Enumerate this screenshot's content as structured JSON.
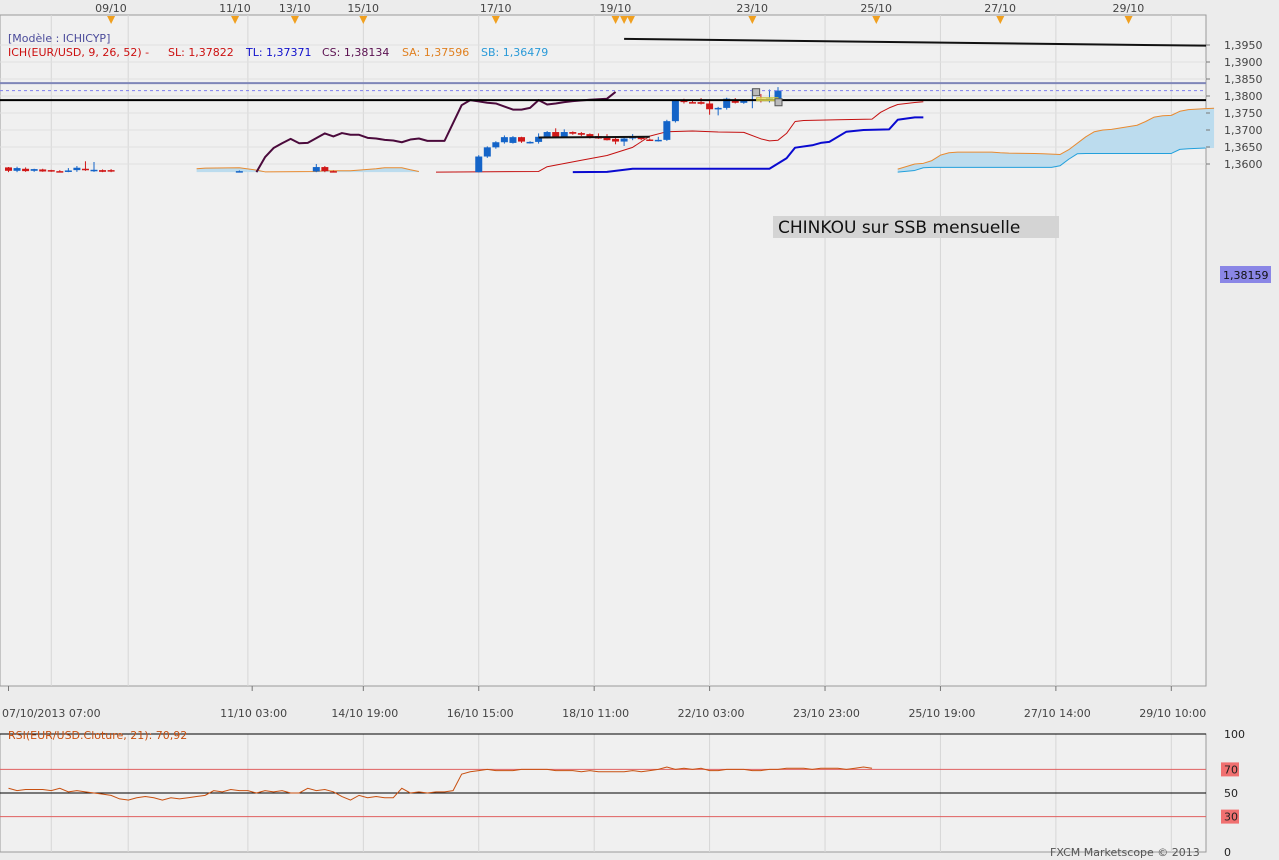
{
  "colors": {
    "background": "#ececec",
    "grid": "#d6d6d6",
    "bull": "#1464c8",
    "bear": "#d01818",
    "tenkan": "#c41010",
    "kijun": "#0a0ad0",
    "chikou": "#4b0a3c",
    "ssa": "#e88a30",
    "ssb": "#22a0dc",
    "cloud": "#bcdcee",
    "hline": "#000000",
    "blue_hline": "#7f86b8",
    "price_dash": "#8080ee",
    "price_tag": "#8a86e6",
    "rsi_line": "#c85010",
    "rsi_level": "#e06060",
    "annotation_bg": "#d6d6d6",
    "highlight": "#f4ee60"
  },
  "header": {
    "model_label": "[Modèle : ICHICYP]",
    "ich_label": "ICH(EUR/USD, 9, 26, 52) -",
    "sl": "SL: 1,37822",
    "tl": "TL: 1,37371",
    "cs": "CS: 1,38134",
    "sa": "SA: 1,37596",
    "sb": "SB: 1,36479"
  },
  "annotation": "CHINKOU sur SSB mensuelle",
  "current_price": "1,38159",
  "footer": "FXCM Marketscope © 2013",
  "chart_data": [
    {
      "type": "candlestick",
      "title": "",
      "symbol": "EUR/USD",
      "indicator": "Ichimoku (9, 26, 52)",
      "ylim": [
        1.3575,
        1.3975
      ],
      "y_ticks": [
        "1,3600",
        "1,3650",
        "1,3700",
        "1,3750",
        "1,3800",
        "1,3850",
        "1,3900",
        "1,3950"
      ],
      "x_tick_labels": [
        "07/10/2013 07:00",
        "11/10 03:00",
        "14/10 19:00",
        "16/10 15:00",
        "18/10 11:00",
        "22/10 03:00",
        "23/10 23:00",
        "25/10 19:00",
        "27/10 14:00",
        "29/10 10:00"
      ],
      "top_date_markers": [
        "09/10",
        "11/10",
        "13/10",
        "15/10",
        "17/10",
        "19/10",
        "23/10",
        "25/10",
        "27/10",
        "29/10"
      ],
      "candles": [
        {
          "i": 0,
          "o": 1.359,
          "h": 1.3591,
          "l": 1.3576,
          "c": 1.358
        },
        {
          "i": 1,
          "o": 1.358,
          "h": 1.3592,
          "l": 1.3576,
          "c": 1.3588
        },
        {
          "i": 2,
          "o": 1.3586,
          "h": 1.359,
          "l": 1.3577,
          "c": 1.3579
        },
        {
          "i": 3,
          "o": 1.358,
          "h": 1.3586,
          "l": 1.3577,
          "c": 1.3585
        },
        {
          "i": 4,
          "o": 1.3584,
          "h": 1.3586,
          "l": 1.3577,
          "c": 1.3578
        },
        {
          "i": 5,
          "o": 1.3582,
          "h": 1.3583,
          "l": 1.3577,
          "c": 1.3579
        },
        {
          "i": 6,
          "o": 1.3579,
          "h": 1.3582,
          "l": 1.3576,
          "c": 1.3577
        },
        {
          "i": 7,
          "o": 1.3579,
          "h": 1.3588,
          "l": 1.3576,
          "c": 1.3581
        },
        {
          "i": 8,
          "o": 1.3582,
          "h": 1.3594,
          "l": 1.3577,
          "c": 1.3589
        },
        {
          "i": 9,
          "o": 1.3586,
          "h": 1.3608,
          "l": 1.358,
          "c": 1.3582
        },
        {
          "i": 10,
          "o": 1.3582,
          "h": 1.3606,
          "l": 1.3577,
          "c": 1.3583
        },
        {
          "i": 11,
          "o": 1.3582,
          "h": 1.3584,
          "l": 1.3576,
          "c": 1.3577
        },
        {
          "i": 12,
          "o": 1.3582,
          "h": 1.3585,
          "l": 1.3576,
          "c": 1.3578
        },
        {
          "i": 27,
          "o": 1.3578,
          "h": 1.3581,
          "l": 1.3576,
          "c": 1.3579
        },
        {
          "i": 36,
          "o": 1.3578,
          "h": 1.36,
          "l": 1.3576,
          "c": 1.3591
        },
        {
          "i": 37,
          "o": 1.3591,
          "h": 1.3594,
          "l": 1.3576,
          "c": 1.3579
        },
        {
          "i": 38,
          "o": 1.3579,
          "h": 1.3581,
          "l": 1.3576,
          "c": 1.3577
        },
        {
          "i": 55,
          "o": 1.3576,
          "h": 1.3626,
          "l": 1.3575,
          "c": 1.3622
        },
        {
          "i": 56,
          "o": 1.3622,
          "h": 1.3652,
          "l": 1.3618,
          "c": 1.3649
        },
        {
          "i": 57,
          "o": 1.3649,
          "h": 1.3667,
          "l": 1.3645,
          "c": 1.3664
        },
        {
          "i": 58,
          "o": 1.3664,
          "h": 1.3684,
          "l": 1.366,
          "c": 1.3679
        },
        {
          "i": 59,
          "o": 1.3662,
          "h": 1.3682,
          "l": 1.366,
          "c": 1.3679
        },
        {
          "i": 60,
          "o": 1.3679,
          "h": 1.368,
          "l": 1.3662,
          "c": 1.3666
        },
        {
          "i": 61,
          "o": 1.3663,
          "h": 1.3667,
          "l": 1.366,
          "c": 1.3665
        },
        {
          "i": 62,
          "o": 1.3665,
          "h": 1.369,
          "l": 1.366,
          "c": 1.368
        },
        {
          "i": 63,
          "o": 1.368,
          "h": 1.3697,
          "l": 1.3675,
          "c": 1.3694
        },
        {
          "i": 64,
          "o": 1.3694,
          "h": 1.3705,
          "l": 1.3676,
          "c": 1.368
        },
        {
          "i": 65,
          "o": 1.368,
          "h": 1.3702,
          "l": 1.3678,
          "c": 1.3694
        },
        {
          "i": 66,
          "o": 1.3694,
          "h": 1.3696,
          "l": 1.3686,
          "c": 1.3689
        },
        {
          "i": 67,
          "o": 1.3691,
          "h": 1.3694,
          "l": 1.3682,
          "c": 1.3686
        },
        {
          "i": 68,
          "o": 1.3688,
          "h": 1.369,
          "l": 1.3675,
          "c": 1.3677
        },
        {
          "i": 69,
          "o": 1.3682,
          "h": 1.369,
          "l": 1.3674,
          "c": 1.3675
        },
        {
          "i": 70,
          "o": 1.3677,
          "h": 1.3688,
          "l": 1.3669,
          "c": 1.367
        },
        {
          "i": 71,
          "o": 1.3674,
          "h": 1.3677,
          "l": 1.3658,
          "c": 1.3666
        },
        {
          "i": 72,
          "o": 1.3666,
          "h": 1.368,
          "l": 1.3653,
          "c": 1.3675
        },
        {
          "i": 73,
          "o": 1.3675,
          "h": 1.3688,
          "l": 1.367,
          "c": 1.368
        },
        {
          "i": 74,
          "o": 1.368,
          "h": 1.3681,
          "l": 1.367,
          "c": 1.3673
        },
        {
          "i": 75,
          "o": 1.3672,
          "h": 1.3675,
          "l": 1.3668,
          "c": 1.367
        },
        {
          "i": 76,
          "o": 1.367,
          "h": 1.368,
          "l": 1.3666,
          "c": 1.3671
        },
        {
          "i": 77,
          "o": 1.3671,
          "h": 1.373,
          "l": 1.3668,
          "c": 1.3726
        },
        {
          "i": 78,
          "o": 1.3726,
          "h": 1.379,
          "l": 1.3722,
          "c": 1.3787
        },
        {
          "i": 79,
          "o": 1.3789,
          "h": 1.3792,
          "l": 1.3778,
          "c": 1.3782
        },
        {
          "i": 80,
          "o": 1.3782,
          "h": 1.3787,
          "l": 1.3778,
          "c": 1.378
        },
        {
          "i": 81,
          "o": 1.3782,
          "h": 1.3794,
          "l": 1.3775,
          "c": 1.3777
        },
        {
          "i": 82,
          "o": 1.3778,
          "h": 1.379,
          "l": 1.3745,
          "c": 1.3761
        },
        {
          "i": 83,
          "o": 1.3761,
          "h": 1.3768,
          "l": 1.3743,
          "c": 1.3765
        },
        {
          "i": 84,
          "o": 1.3765,
          "h": 1.3795,
          "l": 1.376,
          "c": 1.3792
        },
        {
          "i": 85,
          "o": 1.3789,
          "h": 1.3794,
          "l": 1.3778,
          "c": 1.378
        },
        {
          "i": 86,
          "o": 1.378,
          "h": 1.379,
          "l": 1.3777,
          "c": 1.3788
        },
        {
          "i": 87,
          "o": 1.3788,
          "h": 1.3822,
          "l": 1.3764,
          "c": 1.379
        },
        {
          "i": 88,
          "o": 1.3791,
          "h": 1.3806,
          "l": 1.3781,
          "c": 1.379
        },
        {
          "i": 89,
          "o": 1.3791,
          "h": 1.3819,
          "l": 1.3781,
          "c": 1.3793
        },
        {
          "i": 90,
          "o": 1.3793,
          "h": 1.3826,
          "l": 1.378,
          "c": 1.3816
        }
      ],
      "tenkan": [
        [
          50,
          1.3576
        ],
        [
          62,
          1.3578
        ],
        [
          63,
          1.3592
        ],
        [
          67,
          1.3611
        ],
        [
          70,
          1.3625
        ],
        [
          73,
          1.3649
        ],
        [
          75,
          1.3682
        ],
        [
          77,
          1.3695
        ],
        [
          80,
          1.3697
        ],
        [
          83,
          1.3694
        ],
        [
          86,
          1.3693
        ],
        [
          88,
          1.3674
        ],
        [
          89,
          1.3668
        ],
        [
          90,
          1.367
        ],
        [
          91,
          1.369
        ],
        [
          92,
          1.3725
        ],
        [
          93,
          1.3728
        ],
        [
          97,
          1.373
        ],
        [
          101,
          1.3732
        ],
        [
          102,
          1.3752
        ],
        [
          103,
          1.3765
        ],
        [
          104,
          1.3775
        ],
        [
          105,
          1.3778
        ],
        [
          106,
          1.3781
        ],
        [
          107,
          1.3783
        ]
      ],
      "kijun": [
        [
          66,
          1.3576
        ],
        [
          70,
          1.3577
        ],
        [
          73,
          1.3586
        ],
        [
          89,
          1.3586
        ],
        [
          91,
          1.3617
        ],
        [
          92,
          1.3648
        ],
        [
          94,
          1.3655
        ],
        [
          95,
          1.3662
        ],
        [
          96,
          1.3665
        ],
        [
          98,
          1.3695
        ],
        [
          100,
          1.37
        ],
        [
          103,
          1.3702
        ],
        [
          104,
          1.373
        ],
        [
          106,
          1.3737
        ],
        [
          107,
          1.3737
        ]
      ],
      "chikou": [
        [
          29,
          1.3576
        ],
        [
          30,
          1.362
        ],
        [
          31,
          1.3647
        ],
        [
          32,
          1.3661
        ],
        [
          33,
          1.3674
        ],
        [
          34,
          1.3661
        ],
        [
          35,
          1.3662
        ],
        [
          37,
          1.369
        ],
        [
          38,
          1.3681
        ],
        [
          39,
          1.3691
        ],
        [
          40,
          1.3686
        ],
        [
          41,
          1.3686
        ],
        [
          42,
          1.3677
        ],
        [
          43,
          1.3675
        ],
        [
          44,
          1.3671
        ],
        [
          45,
          1.3669
        ],
        [
          46,
          1.3664
        ],
        [
          47,
          1.3672
        ],
        [
          48,
          1.3675
        ],
        [
          49,
          1.3668
        ],
        [
          50,
          1.3668
        ],
        [
          51,
          1.3668
        ],
        [
          53,
          1.3773
        ],
        [
          54,
          1.3788
        ],
        [
          55,
          1.3784
        ],
        [
          56,
          1.378
        ],
        [
          57,
          1.3778
        ],
        [
          59,
          1.376
        ],
        [
          60,
          1.376
        ],
        [
          61,
          1.3765
        ],
        [
          62,
          1.3788
        ],
        [
          63,
          1.3775
        ],
        [
          64,
          1.3778
        ],
        [
          65,
          1.3782
        ],
        [
          66,
          1.3785
        ],
        [
          68,
          1.3789
        ],
        [
          70,
          1.3792
        ],
        [
          71,
          1.3812
        ]
      ],
      "senkou_a": [
        [
          22,
          1.3586
        ],
        [
          23,
          1.3588
        ],
        [
          27,
          1.3589
        ],
        [
          29,
          1.3582
        ],
        [
          30,
          1.3577
        ],
        [
          36,
          1.3578
        ],
        [
          37,
          1.358
        ],
        [
          38,
          1.358
        ],
        [
          40,
          1.358
        ],
        [
          43,
          1.3586
        ],
        [
          44,
          1.3589
        ],
        [
          46,
          1.3589
        ],
        [
          47,
          1.3583
        ],
        [
          48,
          1.3578
        ],
        [
          104,
          1.3585
        ],
        [
          106,
          1.36
        ],
        [
          107,
          1.3602
        ],
        [
          108,
          1.361
        ],
        [
          109,
          1.3626
        ],
        [
          110,
          1.3633
        ],
        [
          111,
          1.3635
        ],
        [
          115,
          1.3635
        ],
        [
          116,
          1.3633
        ],
        [
          117,
          1.3632
        ],
        [
          120,
          1.3631
        ],
        [
          121,
          1.363
        ],
        [
          122,
          1.3629
        ],
        [
          123,
          1.3628
        ],
        [
          124,
          1.3642
        ],
        [
          126,
          1.368
        ],
        [
          127,
          1.3695
        ],
        [
          128,
          1.37
        ],
        [
          129,
          1.3702
        ],
        [
          130,
          1.3706
        ],
        [
          131,
          1.371
        ],
        [
          132,
          1.3714
        ],
        [
          133,
          1.3725
        ],
        [
          134,
          1.3738
        ],
        [
          135,
          1.3742
        ],
        [
          136,
          1.3743
        ],
        [
          137,
          1.3755
        ],
        [
          138,
          1.376
        ],
        [
          140,
          1.3763
        ],
        [
          141,
          1.3764
        ]
      ],
      "senkou_b": [
        [
          104,
          1.3576
        ],
        [
          106,
          1.3581
        ],
        [
          107,
          1.3589
        ],
        [
          108,
          1.359
        ],
        [
          122,
          1.359
        ],
        [
          123,
          1.3595
        ],
        [
          124,
          1.3614
        ],
        [
          125,
          1.363
        ],
        [
          126,
          1.3631
        ],
        [
          136,
          1.3631
        ],
        [
          137,
          1.3643
        ],
        [
          138,
          1.3645
        ],
        [
          140,
          1.3647
        ]
      ],
      "horizontal_lines": [
        1.3788,
        1.3838
      ],
      "trend_segment": [
        [
          62,
          1.3678
        ],
        [
          75,
          1.368
        ]
      ],
      "long_trend_line": [
        [
          72,
          1.3968
        ],
        [
          155,
          1.3948
        ]
      ],
      "highlight_box": [
        87.5,
        90,
        1.3786,
        1.3795
      ],
      "current_price": 1.38159
    },
    {
      "type": "line",
      "title": "RSI(EUR/USD.Cloture, 21): 70,92",
      "series": [
        {
          "name": "RSI(EUR/USD.Cloture, 21)",
          "values": [
            54,
            52,
            53,
            53,
            53,
            52,
            54,
            51,
            52,
            51,
            50,
            49,
            48,
            45,
            44,
            46,
            47,
            46,
            44,
            46,
            45,
            46,
            47,
            48,
            52,
            51,
            53,
            52,
            52,
            50,
            52,
            51,
            52,
            50,
            50,
            54,
            52,
            53,
            51,
            47,
            44,
            48,
            46,
            47,
            46,
            46,
            54,
            50,
            51,
            50,
            51,
            51,
            52,
            66,
            68,
            69,
            70,
            69,
            69,
            69,
            70,
            70,
            70,
            70,
            69,
            69,
            69,
            68,
            69,
            68,
            68,
            68,
            68,
            69,
            68,
            69,
            70,
            72,
            70,
            71,
            70,
            71,
            69,
            69,
            70,
            70,
            70,
            69,
            69,
            70,
            70,
            71,
            71,
            71,
            70,
            71,
            71,
            71,
            70,
            71,
            72,
            71
          ]
        }
      ],
      "ylim": [
        0,
        100
      ],
      "levels": [
        30,
        50,
        70
      ],
      "y_tick_labels": [
        "100",
        "70",
        "50",
        "30",
        "0"
      ]
    }
  ]
}
